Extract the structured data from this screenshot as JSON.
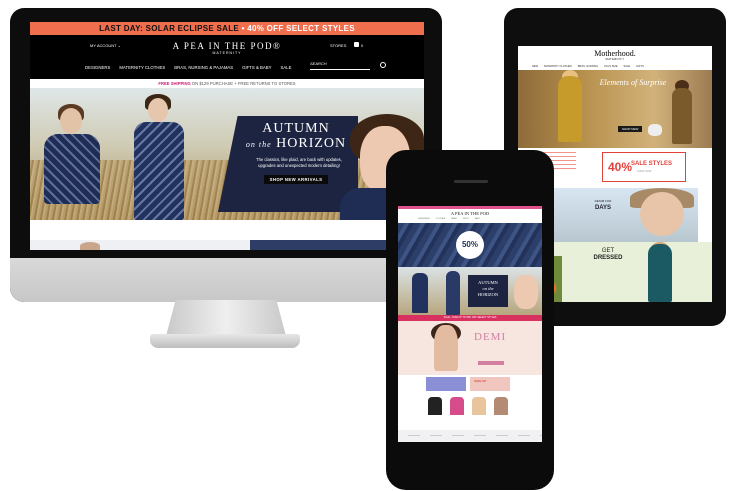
{
  "desktop": {
    "promo": {
      "text_a": "LAST DAY: SOLAR ECLIPSE SALE",
      "text_b": " • 40% OFF SELECT STYLES"
    },
    "header": {
      "account": "MY ACCOUNT ⌄",
      "logo": "A PEA IN THE POD®",
      "logo_sub": "MATERNITY",
      "stores": "STORES",
      "bag_count": "0",
      "search_placeholder": "SEARCH"
    },
    "nav": [
      "DESIGNERS",
      "MATERNITY CLOTHES",
      "BRAS, NURSING & PAJAMAS",
      "GIFTS & BABY",
      "SALE"
    ],
    "shipping": {
      "a": "FREE SHIPPING",
      "b": " ON $129 PURCHASE + FREE RETURNS TO STORES"
    },
    "hero": {
      "title_line1": "AUTUMN",
      "title_on_the": "on the",
      "title_line2": "HORIZON",
      "copy": "The classics, like plaid, are back with updates, upgrades and unexpected modern detailing!",
      "button": "SHOP NEW ARRIVALS"
    }
  },
  "tablet": {
    "logo": "Motherhood.",
    "logo_sub": "MATERNITY",
    "nav": [
      "NEW",
      "MATERNITY CLOTHES",
      "BRAS, NURSING",
      "PLUS SIZE",
      "SALE",
      "GIFTS"
    ],
    "hero_title": "Elements of Surprise",
    "hero_button": "SHOP NEW",
    "sale": {
      "percent": "40%",
      "title": "SALE STYLES",
      "sub": "SHOP NOW"
    },
    "denim": {
      "title": "DENIM FOR",
      "title2": "DAYS"
    },
    "dress": {
      "title": "GET",
      "title2": "DRESSED"
    }
  },
  "phone": {
    "logo": "A PEA IN THE POD",
    "nav": [
      "DESIGNERS",
      "CLOTHES",
      "BRAS",
      "GIFTS",
      "SALE"
    ],
    "denim_badge": "50%",
    "autumn": {
      "line1": "AUTUMN",
      "line2": "on the",
      "line3": "HORIZON"
    },
    "pinkbar": "SALE • TAKE UP TO 50% OFF SELECT STYLES",
    "demi_title": "DEMI",
    "sub_text": "SIGN UP"
  }
}
